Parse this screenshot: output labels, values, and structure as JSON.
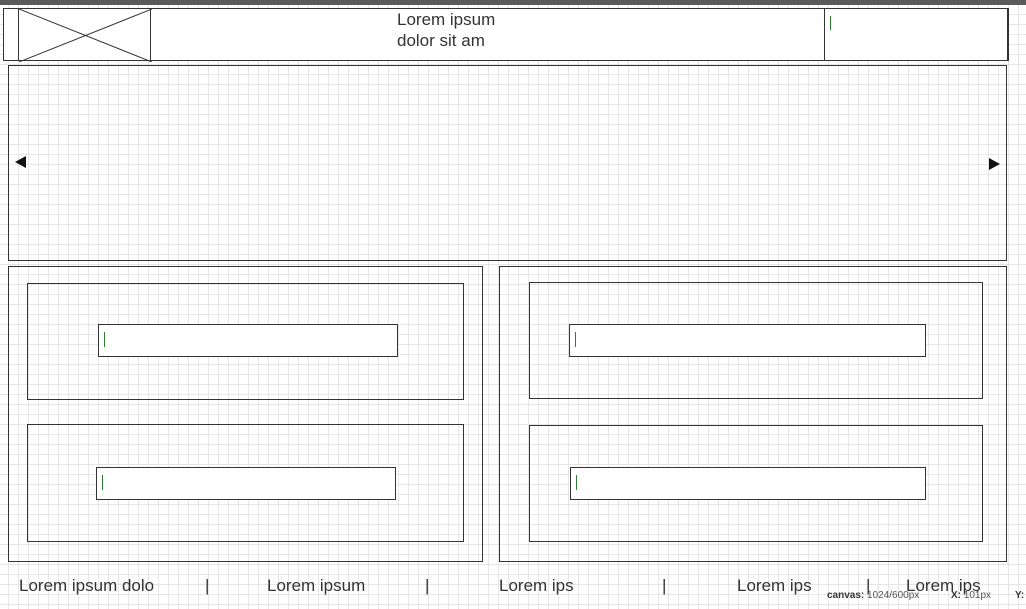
{
  "header": {
    "title_line1": "Lorem ipsum",
    "title_line2": "dolor sit am"
  },
  "icons": {
    "logo": "image-placeholder-icon",
    "prev": "arrow-left-icon",
    "next": "arrow-right-icon"
  },
  "nav": {
    "items": [
      {
        "label": "Lorem ipsum dolo"
      },
      {
        "label": "Lorem ipsum"
      },
      {
        "label": "Lorem ips"
      },
      {
        "label": "Lorem ips"
      },
      {
        "label": "Lorem ips"
      }
    ],
    "separator": "|"
  },
  "status": {
    "canvas_label": "canvas:",
    "canvas_value": "1024/600px",
    "x_label": "X:",
    "x_value": "101px",
    "y_label": "Y:"
  },
  "colors": {
    "grid": "#e6e6e6",
    "border": "#333333",
    "caret": "#2e7d32"
  }
}
